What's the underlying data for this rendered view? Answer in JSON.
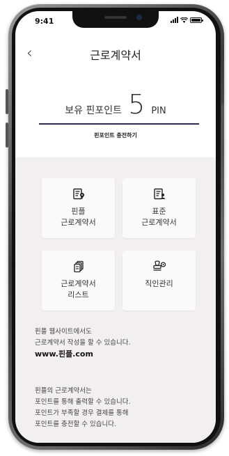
{
  "status_bar": {
    "time": "9:41"
  },
  "header": {
    "back_icon": "chevron-left-icon",
    "title": "근로계약서"
  },
  "points": {
    "label": "보유 핀포인트",
    "value": "5",
    "unit": "PIN"
  },
  "charge_link": "핀포인트 충전하기",
  "menu": [
    {
      "label": "핀플\n근로계약서",
      "icon": "document-pin-icon"
    },
    {
      "label": "표준\n근로계약서",
      "icon": "document-user-icon"
    },
    {
      "label": "근로계약서\n리스트",
      "icon": "stacked-documents-icon"
    },
    {
      "label": "직인관리",
      "icon": "stamp-icon"
    }
  ],
  "info1": {
    "line1": "핀플 웹사이트에서도",
    "line2": "근로계약서 작성을 할 수 있습니다.",
    "url": "www.핀플.com"
  },
  "info2": {
    "line1": "핀플의 근로계약서는",
    "line2": "포인트를 통해 출력할 수 있습니다.",
    "line3": "포인트가 부족할 경우 결제를 통해",
    "line4": "포인트를 충전할 수 있습니다."
  }
}
